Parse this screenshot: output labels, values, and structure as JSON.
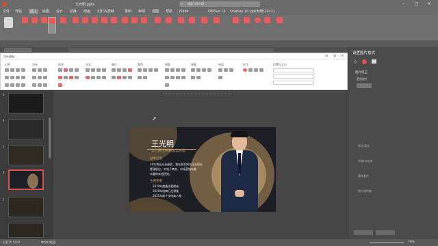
{
  "window": {
    "title": "王光明.pptx",
    "search_placeholder": "搜索 (Alt+Q)"
  },
  "tabs": [
    "文件",
    "开始",
    "插入",
    "绘图",
    "设计",
    "切换",
    "动画",
    "幻灯片放映",
    "录制",
    "审阅",
    "视图",
    "帮助",
    "iSlide",
    "OKPlus",
    "Onekey",
    "Acrobat"
  ],
  "addin_tabs": {
    "okplus": "OKPlus 13",
    "onekey": "OneKey 10",
    "pptbanana": "ppt大师(2022)"
  },
  "panel": {
    "title": "设计面板",
    "groups": [
      "对齐",
      "分布",
      "形状",
      "文本",
      "图片",
      "颜色",
      "线条",
      "效果",
      "布局",
      "尺寸",
      "文字",
      "位置与大小"
    ]
  },
  "slide_numbers": [
    "3",
    "4",
    "5",
    "6",
    "7"
  ],
  "slide": {
    "name": "王光明",
    "subtitle": "华艺网上商城运营总监",
    "section1": "基本信息",
    "line1": "20年商业从业经验，曾在多家知名企业担任",
    "line2": "管理职位，对电子商务、市场营销有着",
    "line3": "丰富的实战经验。",
    "section2": "主要荣誉",
    "bullet1": "2019年度最佳管理者",
    "bullet2": "2020年电商行业领袖",
    "bullet3": "2021年度十佳电商人物"
  },
  "right_pane": {
    "title": "设置图片格式",
    "section": "图片校正",
    "field": "更改图片",
    "notes": [
      "锐化/柔化",
      "亮度/对比度",
      "重新着色",
      "图片透明度"
    ]
  },
  "status": {
    "slide_info": "幻灯片 5/20",
    "language": "中文(中国)",
    "zoom": "70%"
  },
  "colors": {
    "accent": "#c0392b",
    "gold": "#c8a06a",
    "slide_bg": "#1d1f24"
  }
}
